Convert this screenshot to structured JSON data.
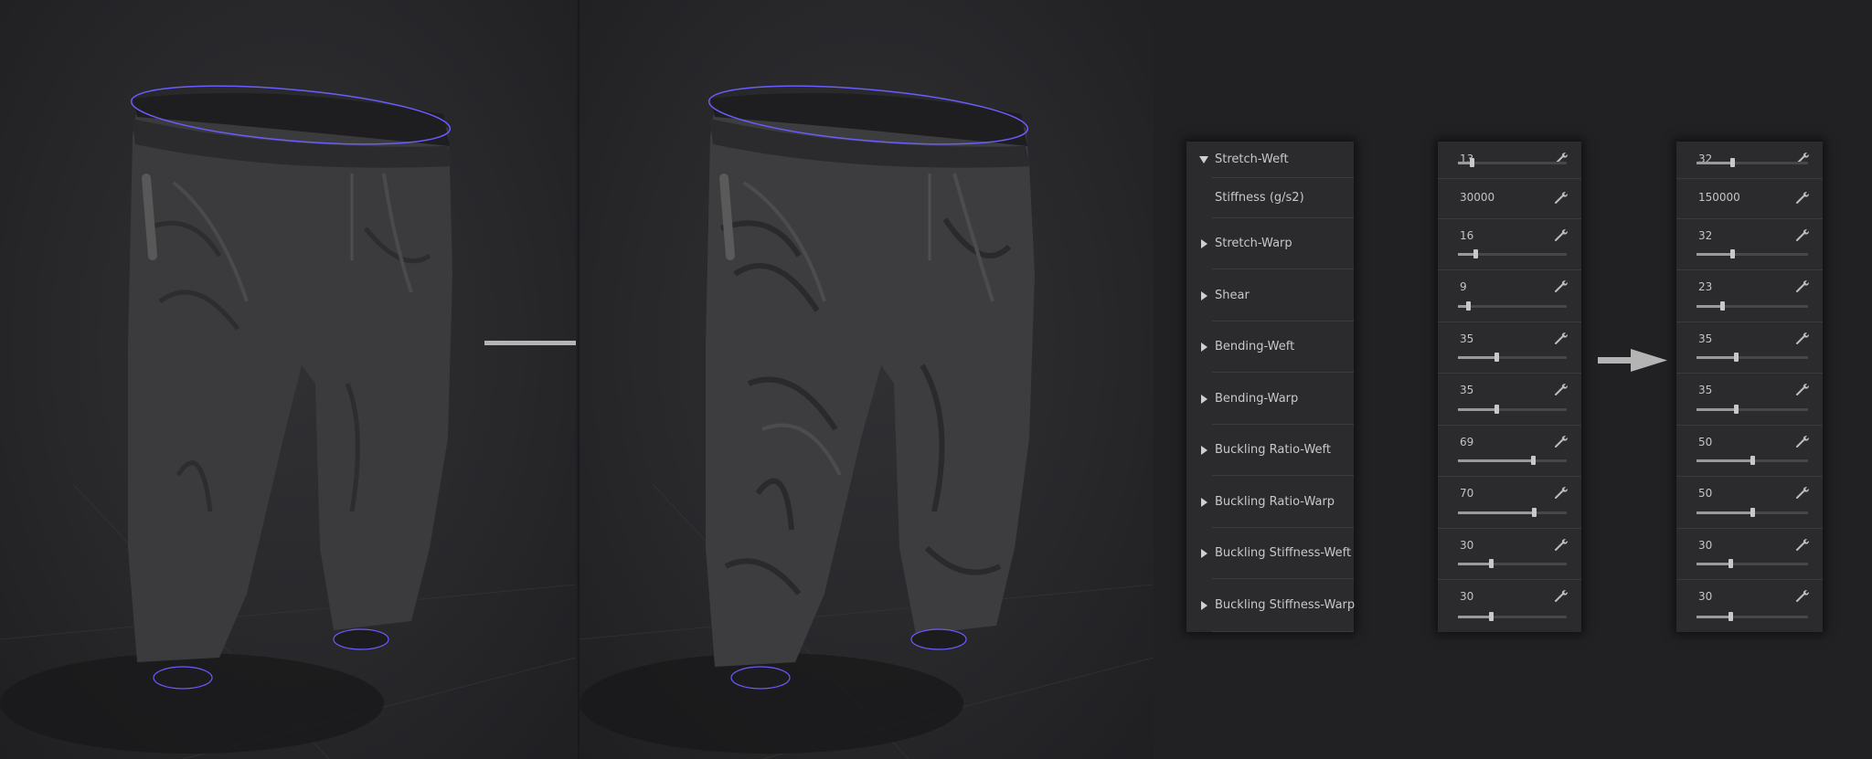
{
  "properties": [
    {
      "label": "Stretch-Weft",
      "expanded": true,
      "before": "13",
      "after": "32",
      "before_pct": 13,
      "after_pct": 32
    },
    {
      "label": "Stiffness (g/s2)",
      "sub": true,
      "before": "30000",
      "after": "150000"
    },
    {
      "label": "Stretch-Warp",
      "before": "16",
      "after": "32",
      "before_pct": 16,
      "after_pct": 32
    },
    {
      "label": "Shear",
      "before": "9",
      "after": "23",
      "before_pct": 9,
      "after_pct": 23
    },
    {
      "label": "Bending-Weft",
      "before": "35",
      "after": "35",
      "before_pct": 35,
      "after_pct": 35
    },
    {
      "label": "Bending-Warp",
      "before": "35",
      "after": "35",
      "before_pct": 35,
      "after_pct": 35
    },
    {
      "label": "Buckling Ratio-Weft",
      "before": "69",
      "after": "50",
      "before_pct": 69,
      "after_pct": 50
    },
    {
      "label": "Buckling Ratio-Warp",
      "before": "70",
      "after": "50",
      "before_pct": 70,
      "after_pct": 50
    },
    {
      "label": "Buckling Stiffness-Weft",
      "before": "30",
      "after": "30",
      "before_pct": 30,
      "after_pct": 30
    },
    {
      "label": "Buckling Stiffness-Warp",
      "before": "30",
      "after": "30",
      "before_pct": 30,
      "after_pct": 30
    }
  ],
  "colors": {
    "background": "#202023",
    "panel": "#2b2b2e",
    "garment": "#3b3b3d",
    "seam_outline": "#6a5cff",
    "arrow": "#b4b4b4"
  },
  "icons": {
    "expand": "triangle-right-icon",
    "collapse": "triangle-down-icon",
    "reset": "wrench-icon",
    "transition": "arrow-right-icon"
  }
}
